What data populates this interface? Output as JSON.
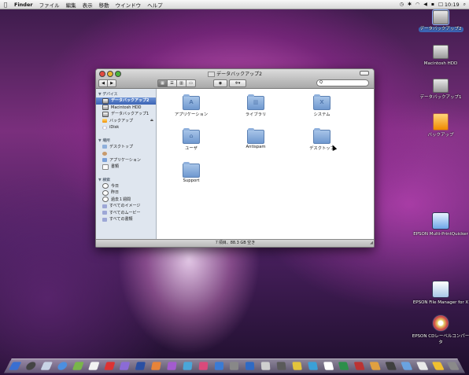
{
  "menubar": {
    "apple": "",
    "items": [
      "Finder",
      "ファイル",
      "編集",
      "表示",
      "移動",
      "ウインドウ",
      "ヘルプ"
    ],
    "clock": "☐ 10:19"
  },
  "desktop_icons": [
    {
      "label": "データバックアップ2"
    },
    {
      "label": "Macintosh HDD"
    },
    {
      "label": "データバックアップ1"
    },
    {
      "label": "バックアップ"
    },
    {
      "label": "EPSON Multi-PrintQuicker"
    },
    {
      "label": "EPSON File Manager for X"
    },
    {
      "label": "EPSON CDレーベルコンパータ"
    }
  ],
  "window": {
    "title": "データバックアップ2",
    "search_placeholder": "Q",
    "sidebar": {
      "devices_header": "▼ デバイス",
      "devices": [
        "データバックアップ2",
        "Macintosh HDD",
        "データバックアップ1",
        "バックアップ",
        "iDisk"
      ],
      "places_header": "▼ 場所",
      "places": [
        "デスクトップ",
        "",
        "アプリケーション",
        "書類"
      ],
      "search_header": "▼ 検索",
      "search_for": [
        "今日",
        "昨日",
        "過去１週間",
        "すべてのイメージ",
        "すべてのムービー",
        "すべての書類"
      ]
    },
    "items": [
      {
        "name": "アプリケーション",
        "glyph": "A"
      },
      {
        "name": "ライブラリ",
        "glyph": "▥"
      },
      {
        "name": "システム",
        "glyph": "X"
      },
      {
        "name": "ユーザ",
        "glyph": "⌂"
      },
      {
        "name": "Antispam",
        "glyph": ""
      },
      {
        "name": "デスクトップ",
        "glyph": ""
      },
      {
        "name": "Support",
        "glyph": ""
      }
    ],
    "status": "７項目、88.3 GB 空き"
  },
  "colors": {
    "selection": "#3b63b4",
    "sidebar_bg": "#dfe6ef",
    "folder": "#7aa0d8"
  }
}
